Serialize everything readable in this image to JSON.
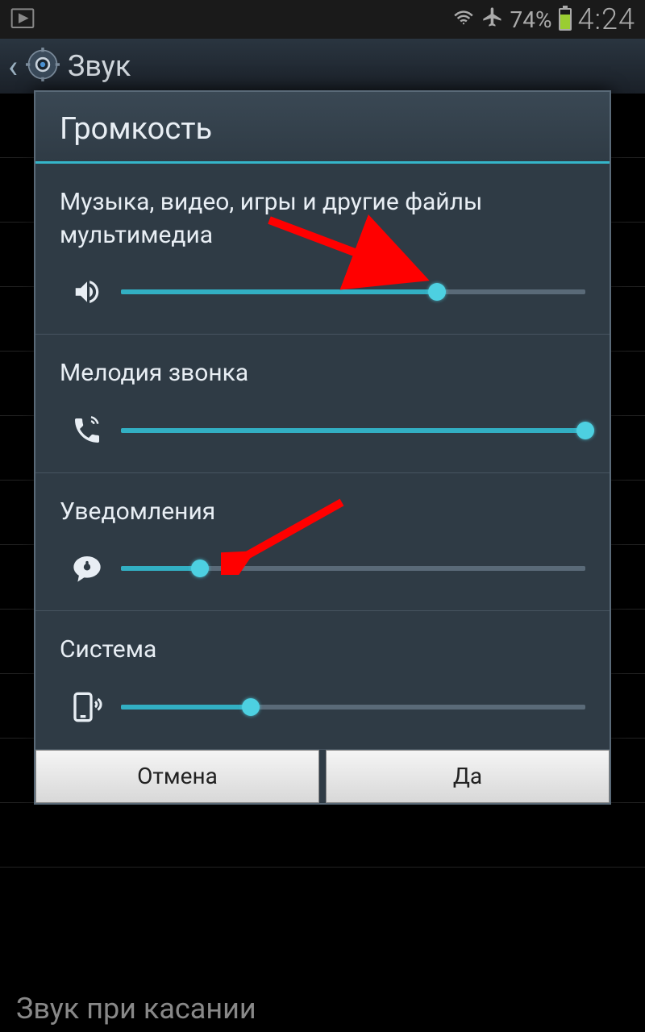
{
  "status_bar": {
    "battery_percent": "74%",
    "time": "4:24"
  },
  "header": {
    "title": "Звук"
  },
  "background": {
    "bottom_item": "Звук при касании"
  },
  "dialog": {
    "title": "Громкость",
    "sliders": [
      {
        "label": "Музыка, видео, игры и другие файлы мультимедиа",
        "value_percent": 68
      },
      {
        "label": "Мелодия звонка",
        "value_percent": 100
      },
      {
        "label": "Уведомления",
        "value_percent": 17
      },
      {
        "label": "Система",
        "value_percent": 28
      }
    ],
    "cancel_label": "Отмена",
    "ok_label": "Да"
  }
}
